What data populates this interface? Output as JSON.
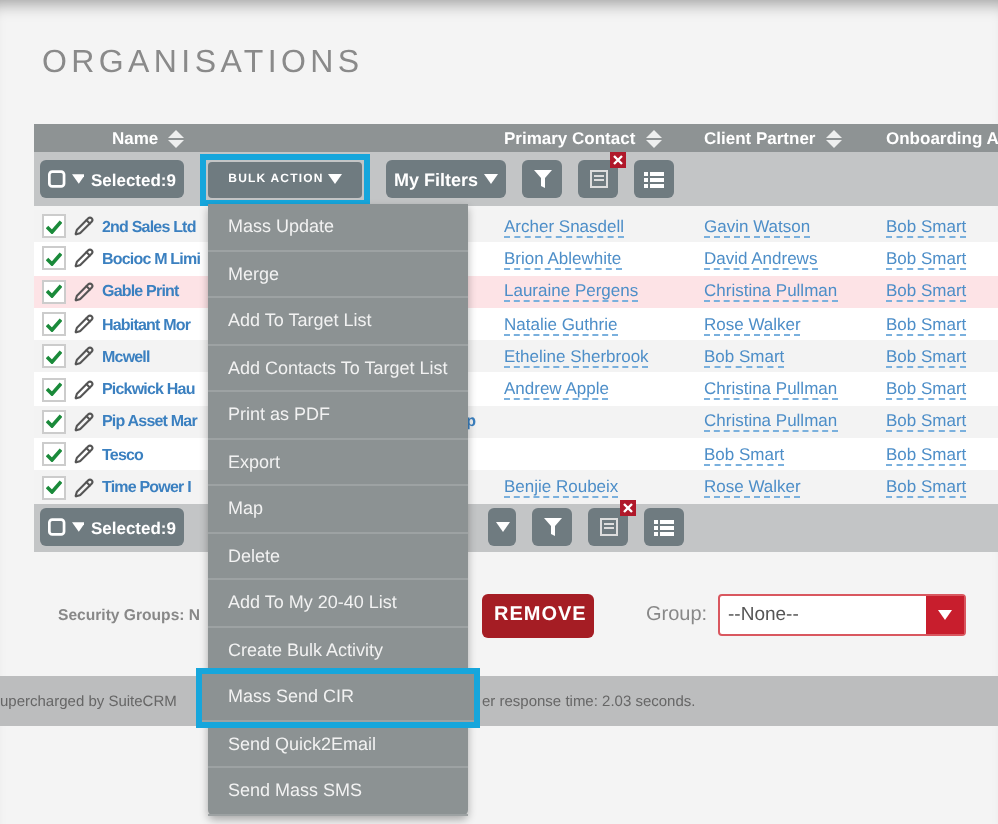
{
  "title": "ORGANISATIONS",
  "columns": [
    {
      "label": "Name"
    },
    {
      "label": "Primary Contact"
    },
    {
      "label": "Client Partner"
    },
    {
      "label": "Onboarding A"
    }
  ],
  "toolbar": {
    "selected": "Selected:9",
    "bulk_action": "BULK ACTION",
    "filters": "My Filters"
  },
  "rows": [
    {
      "checked": true,
      "highlighted": false,
      "name": "2nd Sales Ltd",
      "primary_contact": "Archer Snasdell",
      "client_partner": "Gavin Watson",
      "onboarding": "Bob Smart"
    },
    {
      "checked": true,
      "highlighted": false,
      "name": "Bocioc M Limi",
      "primary_contact": "Brion Ablewhite",
      "client_partner": "David Andrews",
      "onboarding": "Bob Smart"
    },
    {
      "checked": true,
      "highlighted": true,
      "name": "Gable Print",
      "primary_contact": "Lauraine Pergens",
      "client_partner": "Christina Pullman",
      "onboarding": "Bob Smart"
    },
    {
      "checked": true,
      "highlighted": false,
      "name": "Habitant Mor",
      "primary_contact": "Natalie Guthrie",
      "client_partner": "Rose Walker",
      "onboarding": "Bob Smart"
    },
    {
      "checked": true,
      "highlighted": false,
      "name": "Mcwell",
      "primary_contact": "Etheline Sherbrook",
      "client_partner": "Bob Smart",
      "onboarding": "Bob Smart"
    },
    {
      "checked": true,
      "highlighted": false,
      "name": "Pickwick Hau",
      "primary_contact": "Andrew Apple",
      "client_partner": "Christina Pullman",
      "onboarding": "Bob Smart"
    },
    {
      "checked": true,
      "highlighted": false,
      "name": "Pip Asset Mar",
      "name_tail": "p",
      "client_partner": "Christina Pullman",
      "onboarding": "Bob Smart"
    },
    {
      "checked": true,
      "highlighted": false,
      "name": "Tesco",
      "client_partner": "Bob Smart",
      "onboarding": "Bob Smart"
    },
    {
      "checked": true,
      "highlighted": false,
      "name": "Time Power I",
      "primary_contact": "Benjie Roubeix",
      "client_partner": "Rose Walker",
      "onboarding": "Bob Smart"
    }
  ],
  "bottom_toolbar": {
    "selected": "Selected:9"
  },
  "bulk_menu": [
    {
      "label": "Mass Update",
      "selected": false
    },
    {
      "label": "Merge",
      "selected": false
    },
    {
      "label": "Add To Target List",
      "selected": false
    },
    {
      "label": "Add Contacts To Target List",
      "selected": false
    },
    {
      "label": "Print as PDF",
      "selected": false
    },
    {
      "label": "Export",
      "selected": false
    },
    {
      "label": "Map",
      "selected": false
    },
    {
      "label": "Delete",
      "selected": false
    },
    {
      "label": "Add To My 20-40 List",
      "selected": false
    },
    {
      "label": "Create Bulk Activity",
      "selected": false
    },
    {
      "label": "Mass Send CIR",
      "selected": true
    },
    {
      "label": "Send Quick2Email",
      "selected": false
    },
    {
      "label": "Send Mass SMS",
      "selected": false
    }
  ],
  "security_groups": {
    "label": "Security Groups: N",
    "remove": "REMOVE",
    "group_label": "Group:",
    "group_value": "--None--"
  },
  "footer": {
    "left": "upercharged by SuiteCRM",
    "right": "er response time: 2.03 seconds."
  }
}
